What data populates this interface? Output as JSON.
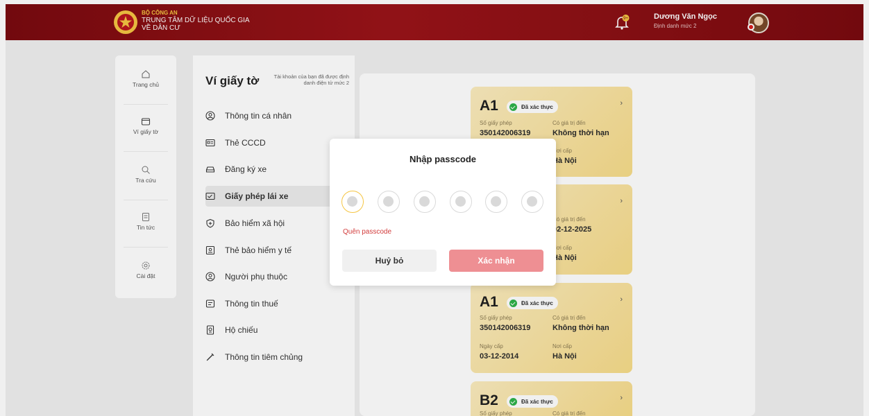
{
  "header": {
    "org_line1": "BỘ CÔNG AN",
    "org_line2": "TRUNG TÂM DỮ LIỆU QUỐC GIA",
    "org_line3": "VỀ DÂN CƯ",
    "notification_count": "9+",
    "user_name": "Dương Văn Ngọc",
    "user_level": "Định danh mức 2"
  },
  "sidebar": {
    "items": [
      {
        "label": "Trang chủ",
        "icon": "home-icon"
      },
      {
        "label": "Ví giấy tờ",
        "icon": "wallet-icon"
      },
      {
        "label": "Tra cứu",
        "icon": "search-icon"
      },
      {
        "label": "Tin tức",
        "icon": "news-icon"
      },
      {
        "label": "Cài đặt",
        "icon": "settings-icon"
      }
    ]
  },
  "wallet": {
    "title": "Ví giấy tờ",
    "note": "Tài khoản của bạn đã được định danh điện tử mức 2",
    "menu": [
      {
        "label": "Thông tin cá nhân",
        "icon": "person-icon"
      },
      {
        "label": "Thẻ CCCD",
        "icon": "id-card-icon"
      },
      {
        "label": "Đăng ký xe",
        "icon": "car-icon"
      },
      {
        "label": "Giấy phép lái xe",
        "icon": "license-icon"
      },
      {
        "label": "Bảo hiểm xã hội",
        "icon": "shield-icon"
      },
      {
        "label": "Thẻ bảo hiểm y tế",
        "icon": "health-card-icon"
      },
      {
        "label": "Người phụ thuộc",
        "icon": "dependent-icon"
      },
      {
        "label": "Thông tin thuế",
        "icon": "tax-icon"
      },
      {
        "label": "Hộ chiếu",
        "icon": "passport-icon"
      },
      {
        "label": "Thông tin tiêm chủng",
        "icon": "vaccine-icon"
      }
    ]
  },
  "cards": [
    {
      "class": "A1",
      "status": "Đã xác thực",
      "no_label": "Số giấy phép",
      "no": "350142006319",
      "valid_label": "Có giá trị đến",
      "valid": "Không thời hạn",
      "date_label": "",
      "date": "",
      "place_label": "Nơi cấp",
      "place": "Hà Nội"
    },
    {
      "class": "",
      "status": "",
      "no_label": "",
      "no": "",
      "valid_label": "Có giá trị đến",
      "valid": "02-12-2025",
      "date_label": "",
      "date": "",
      "place_label": "Nơi cấp",
      "place": "Hà Nội"
    },
    {
      "class": "A1",
      "status": "Đã xác thực",
      "no_label": "Số giấy phép",
      "no": "350142006319",
      "valid_label": "Có giá trị đến",
      "valid": "Không thời hạn",
      "date_label": "Ngày cấp",
      "date": "03-12-2014",
      "place_label": "Nơi cấp",
      "place": "Hà Nội"
    },
    {
      "class": "B2",
      "status": "Đã xác thực",
      "no_label": "Số giấy phép",
      "no": "",
      "valid_label": "Có giá trị đến",
      "valid": "",
      "date_label": "",
      "date": "",
      "place_label": "",
      "place": ""
    }
  ],
  "modal": {
    "title": "Nhập passcode",
    "forgot": "Quên passcode",
    "cancel": "Huỷ bỏ",
    "confirm": "Xác nhận",
    "digits": 6
  },
  "colors": {
    "header_red": "#8c1015",
    "accent_gold": "#f5c542",
    "confirm_pink": "#ee8f93",
    "card_gold": "#f7dc8a"
  }
}
